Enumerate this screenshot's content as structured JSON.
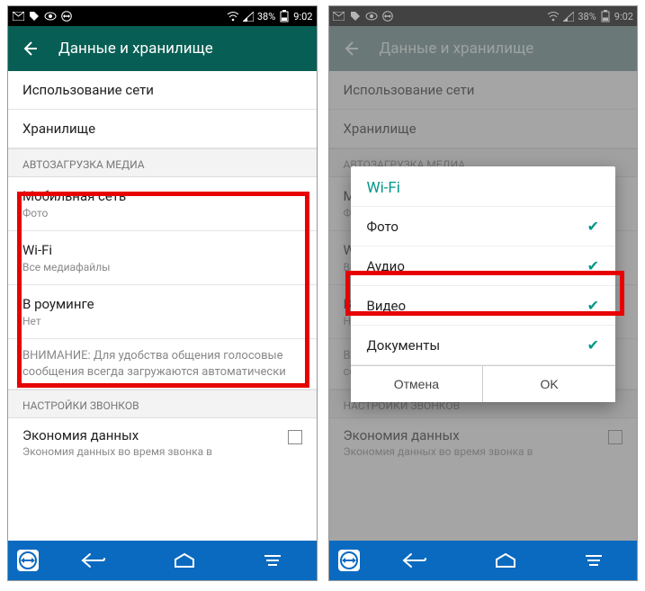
{
  "status": {
    "battery": "38%",
    "time": "9:02"
  },
  "header": {
    "title": "Данные и хранилище"
  },
  "left": {
    "item_network": "Использование сети",
    "item_storage": "Хранилище",
    "section_autodl": "АВТОЗАГРУЗКА МЕДИА",
    "mobile_label": "Мобильная сеть",
    "mobile_sub": "Фото",
    "wifi_label": "Wi-Fi",
    "wifi_sub": "Все медиафайлы",
    "roaming_label": "В роуминге",
    "roaming_sub": "Нет",
    "note": "ВНИМАНИЕ: Для удобства общения голосовые сообщения всегда загружаются автоматически",
    "section_calls": "НАСТРОЙКИ ЗВОНКОВ",
    "low_data_label": "Экономия данных",
    "low_data_sub": "Экономия данных во время звонка в"
  },
  "dialog": {
    "title": "Wi-Fi",
    "opt_photo": "Фото",
    "opt_audio": "Аудио",
    "opt_video": "Видео",
    "opt_docs": "Документы",
    "cancel": "Отмена",
    "ok": "OK"
  }
}
